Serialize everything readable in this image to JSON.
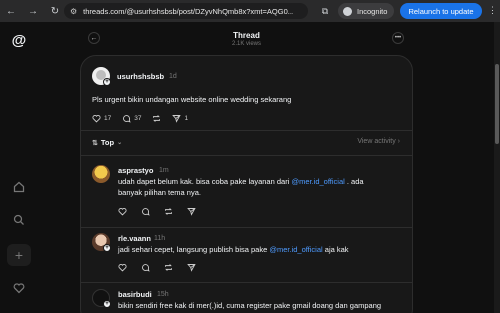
{
  "browser": {
    "url": "threads.com/@usurhshsbsb/post/DZyvNhQmb8x?xmt=AQG0...",
    "incognito_label": "Incognito",
    "relaunch_label": "Relaunch to update"
  },
  "header": {
    "title": "Thread",
    "views": "2.1K views"
  },
  "post": {
    "username": "usurhshsbsb",
    "time": "1d",
    "text": "Pls urgent bikin undangan website online wedding sekarang",
    "likes": "17",
    "replies": "37",
    "shares": "1"
  },
  "sort": {
    "label": "Top",
    "view_activity": "View activity"
  },
  "replies": [
    {
      "username": "asprastyo",
      "time": "1m",
      "line1_before": "udah dapet belum kak. bisa coba pake layanan dari ",
      "mention": "@mer.id_official",
      "line1_after": " . ada",
      "line2": "banyak pilihan tema nya."
    },
    {
      "username": "rle.vaann",
      "time": "11h",
      "line1_before": "jadi sehari cepet, langsung publish bisa pake ",
      "mention": "@mer.id_official",
      "line1_after": " aja kak"
    },
    {
      "username": "basirbudi",
      "time": "15h",
      "line1": "bikin sendiri free kak di mer(.)id, cuma register pake gmail doang dan gampang"
    }
  ],
  "colors": {
    "accent": "#1a73e8",
    "mention": "#4e9bff",
    "background": "#101010",
    "card": "#181818"
  }
}
